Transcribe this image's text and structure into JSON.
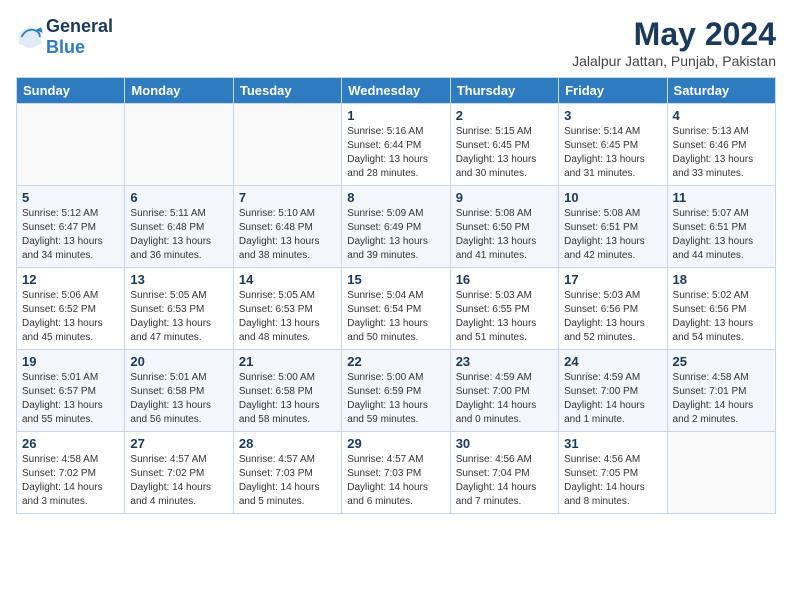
{
  "logo": {
    "general": "General",
    "blue": "Blue"
  },
  "title": {
    "month_year": "May 2024",
    "location": "Jalalpur Jattan, Punjab, Pakistan"
  },
  "headers": [
    "Sunday",
    "Monday",
    "Tuesday",
    "Wednesday",
    "Thursday",
    "Friday",
    "Saturday"
  ],
  "weeks": [
    [
      {
        "day": "",
        "info": ""
      },
      {
        "day": "",
        "info": ""
      },
      {
        "day": "",
        "info": ""
      },
      {
        "day": "1",
        "info": "Sunrise: 5:16 AM\nSunset: 6:44 PM\nDaylight: 13 hours\nand 28 minutes."
      },
      {
        "day": "2",
        "info": "Sunrise: 5:15 AM\nSunset: 6:45 PM\nDaylight: 13 hours\nand 30 minutes."
      },
      {
        "day": "3",
        "info": "Sunrise: 5:14 AM\nSunset: 6:45 PM\nDaylight: 13 hours\nand 31 minutes."
      },
      {
        "day": "4",
        "info": "Sunrise: 5:13 AM\nSunset: 6:46 PM\nDaylight: 13 hours\nand 33 minutes."
      }
    ],
    [
      {
        "day": "5",
        "info": "Sunrise: 5:12 AM\nSunset: 6:47 PM\nDaylight: 13 hours\nand 34 minutes."
      },
      {
        "day": "6",
        "info": "Sunrise: 5:11 AM\nSunset: 6:48 PM\nDaylight: 13 hours\nand 36 minutes."
      },
      {
        "day": "7",
        "info": "Sunrise: 5:10 AM\nSunset: 6:48 PM\nDaylight: 13 hours\nand 38 minutes."
      },
      {
        "day": "8",
        "info": "Sunrise: 5:09 AM\nSunset: 6:49 PM\nDaylight: 13 hours\nand 39 minutes."
      },
      {
        "day": "9",
        "info": "Sunrise: 5:08 AM\nSunset: 6:50 PM\nDaylight: 13 hours\nand 41 minutes."
      },
      {
        "day": "10",
        "info": "Sunrise: 5:08 AM\nSunset: 6:51 PM\nDaylight: 13 hours\nand 42 minutes."
      },
      {
        "day": "11",
        "info": "Sunrise: 5:07 AM\nSunset: 6:51 PM\nDaylight: 13 hours\nand 44 minutes."
      }
    ],
    [
      {
        "day": "12",
        "info": "Sunrise: 5:06 AM\nSunset: 6:52 PM\nDaylight: 13 hours\nand 45 minutes."
      },
      {
        "day": "13",
        "info": "Sunrise: 5:05 AM\nSunset: 6:53 PM\nDaylight: 13 hours\nand 47 minutes."
      },
      {
        "day": "14",
        "info": "Sunrise: 5:05 AM\nSunset: 6:53 PM\nDaylight: 13 hours\nand 48 minutes."
      },
      {
        "day": "15",
        "info": "Sunrise: 5:04 AM\nSunset: 6:54 PM\nDaylight: 13 hours\nand 50 minutes."
      },
      {
        "day": "16",
        "info": "Sunrise: 5:03 AM\nSunset: 6:55 PM\nDaylight: 13 hours\nand 51 minutes."
      },
      {
        "day": "17",
        "info": "Sunrise: 5:03 AM\nSunset: 6:56 PM\nDaylight: 13 hours\nand 52 minutes."
      },
      {
        "day": "18",
        "info": "Sunrise: 5:02 AM\nSunset: 6:56 PM\nDaylight: 13 hours\nand 54 minutes."
      }
    ],
    [
      {
        "day": "19",
        "info": "Sunrise: 5:01 AM\nSunset: 6:57 PM\nDaylight: 13 hours\nand 55 minutes."
      },
      {
        "day": "20",
        "info": "Sunrise: 5:01 AM\nSunset: 6:58 PM\nDaylight: 13 hours\nand 56 minutes."
      },
      {
        "day": "21",
        "info": "Sunrise: 5:00 AM\nSunset: 6:58 PM\nDaylight: 13 hours\nand 58 minutes."
      },
      {
        "day": "22",
        "info": "Sunrise: 5:00 AM\nSunset: 6:59 PM\nDaylight: 13 hours\nand 59 minutes."
      },
      {
        "day": "23",
        "info": "Sunrise: 4:59 AM\nSunset: 7:00 PM\nDaylight: 14 hours\nand 0 minutes."
      },
      {
        "day": "24",
        "info": "Sunrise: 4:59 AM\nSunset: 7:00 PM\nDaylight: 14 hours\nand 1 minute."
      },
      {
        "day": "25",
        "info": "Sunrise: 4:58 AM\nSunset: 7:01 PM\nDaylight: 14 hours\nand 2 minutes."
      }
    ],
    [
      {
        "day": "26",
        "info": "Sunrise: 4:58 AM\nSunset: 7:02 PM\nDaylight: 14 hours\nand 3 minutes."
      },
      {
        "day": "27",
        "info": "Sunrise: 4:57 AM\nSunset: 7:02 PM\nDaylight: 14 hours\nand 4 minutes."
      },
      {
        "day": "28",
        "info": "Sunrise: 4:57 AM\nSunset: 7:03 PM\nDaylight: 14 hours\nand 5 minutes."
      },
      {
        "day": "29",
        "info": "Sunrise: 4:57 AM\nSunset: 7:03 PM\nDaylight: 14 hours\nand 6 minutes."
      },
      {
        "day": "30",
        "info": "Sunrise: 4:56 AM\nSunset: 7:04 PM\nDaylight: 14 hours\nand 7 minutes."
      },
      {
        "day": "31",
        "info": "Sunrise: 4:56 AM\nSunset: 7:05 PM\nDaylight: 14 hours\nand 8 minutes."
      },
      {
        "day": "",
        "info": ""
      }
    ]
  ]
}
